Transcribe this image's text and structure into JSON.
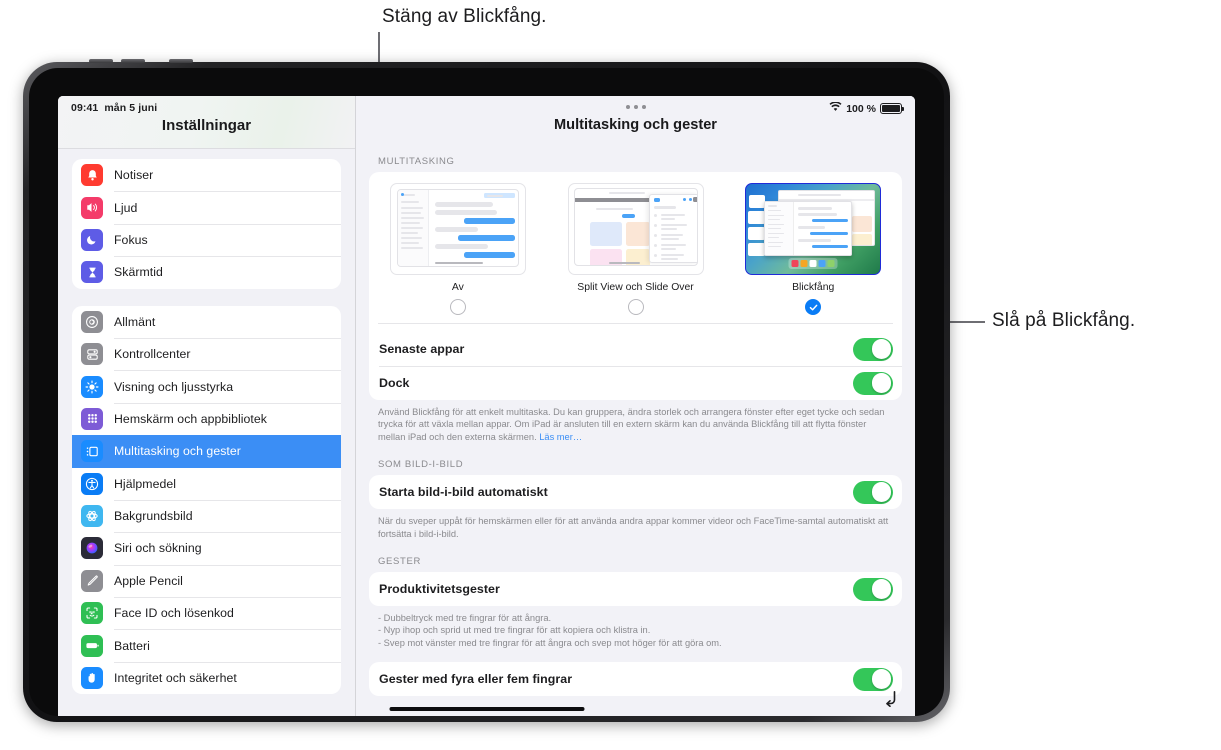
{
  "annotations": {
    "left_callout": "Stäng av Blickfång.",
    "right_callout": "Slå på Blickfång."
  },
  "status_bar": {
    "time": "09:41",
    "date": "mån 5 juni",
    "battery_percent": "100 %",
    "wifi_icon": "wifi-icon",
    "battery_icon": "battery-full-icon"
  },
  "sidebar": {
    "title": "Inställningar",
    "groups": [
      {
        "items": [
          {
            "label": "Notiser",
            "icon": "notifications-icon",
            "color": "#ff3b30",
            "selected": false
          },
          {
            "label": "Ljud",
            "icon": "sound-icon",
            "color": "#f43b69",
            "selected": false
          },
          {
            "label": "Fokus",
            "icon": "focus-moon-icon",
            "color": "#5e5ce6",
            "selected": false
          },
          {
            "label": "Skärmtid",
            "icon": "screentime-hourglass-icon",
            "color": "#5e5ce6",
            "selected": false
          }
        ]
      },
      {
        "items": [
          {
            "label": "Allmänt",
            "icon": "general-gear-icon",
            "color": "#8e8e93",
            "selected": false
          },
          {
            "label": "Kontrollcenter",
            "icon": "control-center-icon",
            "color": "#8e8e93",
            "selected": false
          },
          {
            "label": "Visning och ljusstyrka",
            "icon": "brightness-icon",
            "color": "#1a8cff",
            "selected": false
          },
          {
            "label": "Hemskärm och appbibliotek",
            "icon": "home-screen-icon",
            "color": "#7d5bd6",
            "selected": false
          },
          {
            "label": "Multitasking och gester",
            "icon": "multitasking-icon",
            "color": "#1a8cff",
            "selected": true
          },
          {
            "label": "Hjälpmedel",
            "icon": "accessibility-icon",
            "color": "#0a7cf5",
            "selected": false
          },
          {
            "label": "Bakgrundsbild",
            "icon": "wallpaper-icon",
            "color": "#3fb7f0",
            "selected": false
          },
          {
            "label": "Siri och sökning",
            "icon": "siri-icon",
            "color": "#2b2b38",
            "selected": false
          },
          {
            "label": "Apple Pencil",
            "icon": "apple-pencil-icon",
            "color": "#8e8e93",
            "selected": false
          },
          {
            "label": "Face ID och lösenkod",
            "icon": "face-id-icon",
            "color": "#2fbf54",
            "selected": false
          },
          {
            "label": "Batteri",
            "icon": "battery-icon",
            "color": "#2fbf54",
            "selected": false
          },
          {
            "label": "Integritet och säkerhet",
            "icon": "privacy-hand-icon",
            "color": "#1a8cff",
            "selected": false
          }
        ]
      }
    ]
  },
  "main": {
    "title": "Multitasking och gester",
    "overflow_icon": "more-dots-icon",
    "sections": {
      "multitasking": {
        "header": "MULTITASKING",
        "options": [
          {
            "label": "Av",
            "selected": false
          },
          {
            "label": "Split View och Slide Over",
            "selected": false
          },
          {
            "label": "Blickfång",
            "selected": true
          }
        ],
        "rows": [
          {
            "label": "Senaste appar",
            "on": true
          },
          {
            "label": "Dock",
            "on": true
          }
        ],
        "footnote": "Använd Blickfång för att enkelt multitaska. Du kan gruppera, ändra storlek och arrangera fönster efter eget tycke och sedan trycka för att växla mellan appar. Om iPad är ansluten till en extern skärm kan du använda Blickfång till att flytta fönster mellan iPad och den externa skärmen. ",
        "footnote_link": "Läs mer…"
      },
      "pip": {
        "header": "SOM BILD-I-BILD",
        "rows": [
          {
            "label": "Starta bild-i-bild automatiskt",
            "on": true
          }
        ],
        "footnote": "När du sveper uppåt för hemskärmen eller för att använda andra appar kommer videor och FaceTime-samtal automatiskt att fortsätta i bild-i-bild."
      },
      "gestures": {
        "header": "GESTER",
        "rows": [
          {
            "label": "Produktivitetsgester",
            "on": true
          }
        ],
        "footnote_lines": [
          "- Dubbeltryck med tre fingrar för att ångra.",
          "- Nyp ihop och sprid ut med tre fingrar för att kopiera och klistra in.",
          "- Svep mot vänster med tre fingrar för att ångra och svep mot höger för att göra om."
        ],
        "rows2": [
          {
            "label": "Gester med fyra eller fem fingrar",
            "on": true
          }
        ]
      }
    }
  },
  "colors": {
    "accent_blue": "#0a7cf5",
    "selected_row_blue": "#3b8ef5",
    "switch_green": "#34c759",
    "link_blue": "#3b8ef5",
    "screen_bg": "#f2f2f7"
  }
}
